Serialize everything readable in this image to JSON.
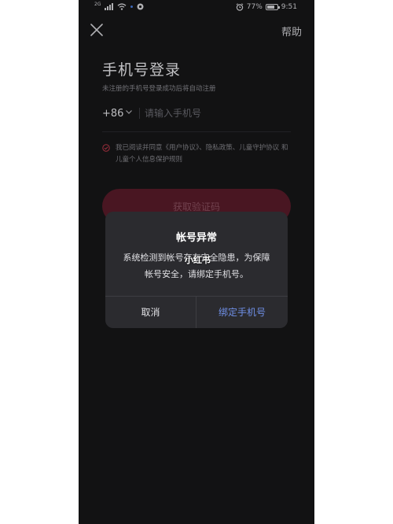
{
  "status_bar": {
    "network_label": "2G",
    "battery_percent": "77%",
    "battery_level": 0.77,
    "time": "9:51"
  },
  "header": {
    "close_icon": "close-icon",
    "help_label": "帮助"
  },
  "login": {
    "title": "手机号登录",
    "subtitle": "未注册的手机号登录成功后将自动注册",
    "country_code": "+86",
    "phone_placeholder": "请输入手机号",
    "phone_value": "",
    "agreement_text": "我已阅读并同意《用户协议》、隐私政策、儿童守护协议 和 儿童个人信息保护规则",
    "get_code_label": "获取验证码"
  },
  "dialog": {
    "title": "帐号异常",
    "message": "系统检测到帐号存在安全隐患，为保障帐号安全，请绑定手机号。",
    "cancel_label": "取消",
    "bind_label": "绑定手机号"
  },
  "watermark": {
    "text": "小红书"
  },
  "colors": {
    "background": "#161618",
    "dialog_bg": "#2b2b2f",
    "accent_blue": "#6f8fe6",
    "button_red": "#5a1b2a",
    "check_red": "#c0394a"
  }
}
